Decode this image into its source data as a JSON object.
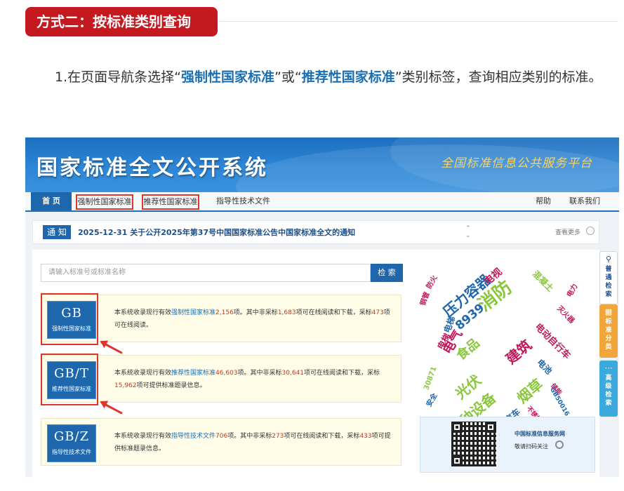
{
  "article": {
    "section_title": "方式二：按标准类别查询",
    "para_pre": "1.在页面导航条选择“",
    "para_link1": "强制性国家标准",
    "para_mid": "”或“",
    "para_link2": "推荐性国家标准",
    "para_post": "”类别标签，查询相应类别的标准。"
  },
  "site": {
    "title": "国家标准全文公开系统",
    "slogan": "全国标准信息公共服务平台"
  },
  "nav": {
    "home": "首 页",
    "mandatory": "强制性国家标准",
    "recommended": "推荐性国家标准",
    "guidance": "指导性技术文件",
    "help": "帮助",
    "contact": "联系我们"
  },
  "notice": {
    "tag": "通 知",
    "text": "2025-12-31  关于公开2025年第37号中国国家标准公告中国家标准全文的通知",
    "arrows_up": "⌃",
    "arrows_down": "⌄",
    "more": "查看更多"
  },
  "search": {
    "placeholder": "请输入标准号或标准名称",
    "button": "检 索"
  },
  "cards": [
    {
      "code": "GB",
      "sub": "强制性国家标准",
      "d1": "本系统收录现行有效",
      "d_link": "强制性国家标准",
      "d_n1": "2,156",
      "d2": "项。其中非采标",
      "d_n2": "1,683",
      "d3": "项可在线阅读和下载，采标",
      "d_n3": "473",
      "d4": "项可在线阅读。"
    },
    {
      "code": "GB/T",
      "sub": "推荐性国家标准",
      "d1": "本系统收录现行有效",
      "d_link": "推荐性国家标准",
      "d_n1": "46,603",
      "d2": "项。其中非采标",
      "d_n2": "30,641",
      "d3": "项可在线阅读和下载，采标",
      "d_n3": "15,962",
      "d4": "项可提供标准题录信息。"
    },
    {
      "code": "GB/Z",
      "sub": "指导性技术文件",
      "d1": "本系统收录现行有效",
      "d_link": "指导性技术文件",
      "d_n1": "706",
      "d2": "项。其中非采标",
      "d_n2": "273",
      "d3": "项可在线阅读和下载，采标",
      "d_n3": "433",
      "d4": "项可提供标准题录信息。"
    }
  ],
  "word_cloud": [
    {
      "text": "消防",
      "color": "#8cc63f"
    },
    {
      "text": "压力容器",
      "color": "#1f67ad"
    },
    {
      "text": "8939",
      "color": "#1f67ad"
    },
    {
      "text": "食品",
      "color": "#8cc63f"
    },
    {
      "text": "建筑",
      "color": "#c2185b"
    },
    {
      "text": "光伏",
      "color": "#8cc63f"
    },
    {
      "text": "电气",
      "color": "#c2185b"
    },
    {
      "text": "特种设备",
      "color": "#8cc63f"
    },
    {
      "text": "烟草",
      "color": "#8cc63f"
    },
    {
      "text": "电动自行车",
      "color": "#c2185b"
    },
    {
      "text": "混凝土",
      "color": "#8cc63f"
    },
    {
      "text": "电梯",
      "color": "#1f67ad"
    },
    {
      "text": "电视",
      "color": "#c2185b"
    },
    {
      "text": "电池",
      "color": "#1f67ad"
    },
    {
      "text": "汽车",
      "color": "#1f67ad"
    },
    {
      "text": "防火",
      "color": "#c2185b"
    },
    {
      "text": "电力",
      "color": "#c2185b"
    },
    {
      "text": "钢管",
      "color": "#c2185b"
    },
    {
      "text": "灭火器",
      "color": "#c2185b"
    },
    {
      "text": "30871",
      "color": "#8cc63f"
    },
    {
      "text": "安全",
      "color": "#1f67ad"
    },
    {
      "text": "储能",
      "color": "#c2185b"
    },
    {
      "text": "不锈钢",
      "color": "#c2185b"
    },
    {
      "text": "GB50016",
      "color": "#1f67ad"
    },
    {
      "text": "电梯",
      "color": "#c2185b"
    }
  ],
  "qr": {
    "name": "中国标准信息服务网",
    "follow": "敬请扫码关注"
  },
  "sidebar": {
    "basic_icon": "search-icon",
    "basic": "普通检索",
    "class_icon": "grid-icon",
    "class": "标准分类",
    "adv_icon": "dots-icon",
    "adv": "高级检索"
  }
}
